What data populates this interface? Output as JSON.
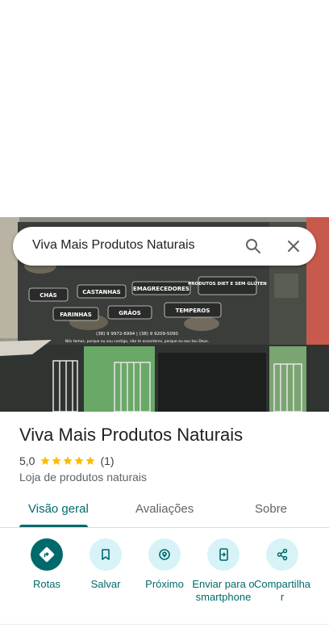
{
  "search": {
    "query": "Viva Mais Produtos Naturais",
    "search_icon": "search-icon",
    "close_icon": "close-icon"
  },
  "hero": {
    "storefront_sign": {
      "items": [
        "CHÁS",
        "CASTANHAS",
        "EMAGRECEDORES",
        "PRODUTOS DIET E SEM GLÚTEN",
        "FARINHAS",
        "GRÃOS",
        "TEMPEROS"
      ],
      "phones": "(38) 9 9972-6994 | (38) 9 9209-5090",
      "slogan": "Nós temos, porque eu sou contigo, não te assombres, porque eu sou teu Deus."
    }
  },
  "place": {
    "name": "Viva Mais Produtos Naturais",
    "rating": "5,0",
    "stars": 5,
    "review_count": "(1)",
    "category": "Loja de produtos naturais"
  },
  "tabs": [
    {
      "label": "Visão geral",
      "active": true
    },
    {
      "label": "Avaliações",
      "active": false
    },
    {
      "label": "Sobre",
      "active": false
    }
  ],
  "actions": [
    {
      "label": "Rotas",
      "icon": "directions-icon"
    },
    {
      "label": "Salvar",
      "icon": "bookmark-icon"
    },
    {
      "label": "Próximo",
      "icon": "nearby-icon"
    },
    {
      "label": "Enviar para o smartphone",
      "icon": "send-to-phone-icon"
    },
    {
      "label": "Compartilhar",
      "icon": "share-icon"
    }
  ],
  "colors": {
    "accent": "#00696b",
    "action_bg": "#d7f3f8",
    "star": "#fbbc04"
  }
}
